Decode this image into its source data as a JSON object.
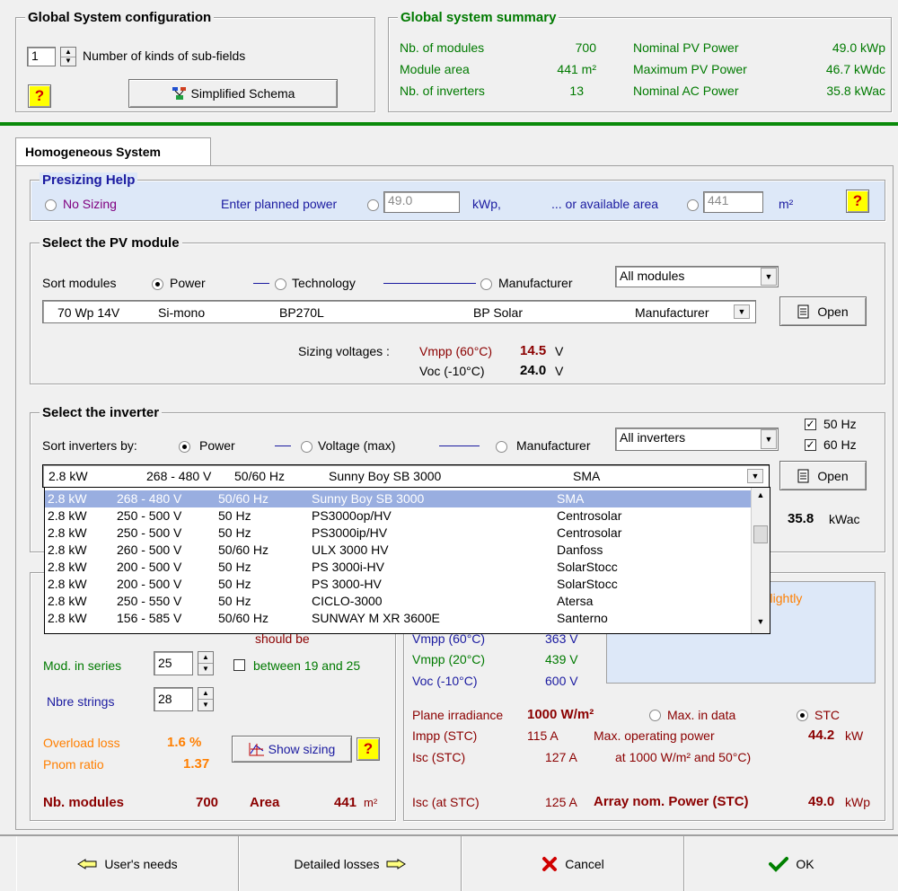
{
  "global_config": {
    "title": "Global System configuration",
    "kinds_value": "1",
    "kinds_label": "Number of kinds of sub-fields",
    "help": "?",
    "schema_button": "Simplified Schema"
  },
  "summary": {
    "title": "Global system summary",
    "rows": [
      {
        "label": "Nb. of modules",
        "value": "700",
        "label2": "Nominal PV Power",
        "value2": "49.0 kWp"
      },
      {
        "label": "Module area",
        "value": "441 m²",
        "label2": "Maximum PV Power",
        "value2": "46.7 kWdc"
      },
      {
        "label": "Nb. of inverters",
        "value": "13",
        "label2": "Nominal AC Power",
        "value2": "35.8 kWac"
      }
    ]
  },
  "tab": {
    "label": "Homogeneous System"
  },
  "presizing": {
    "title": "Presizing Help",
    "no_sizing": "No Sizing",
    "planned_power_label": "Enter planned power",
    "planned_power_value": "49.0",
    "planned_power_unit": "kWp,",
    "area_label": "... or available area",
    "area_value": "441",
    "area_unit": "m²",
    "help": "?"
  },
  "pv_module": {
    "title": "Select the PV module",
    "sort_label": "Sort modules",
    "sort_power": "Power",
    "sort_technology": "Technology",
    "sort_manufacturer": "Manufacturer",
    "filter_value": "All modules",
    "selected": {
      "power": "70 Wp 14V",
      "tech": "Si-mono",
      "model": "BP270L",
      "maker": "BP Solar",
      "source": "Manufacturer"
    },
    "open_button": "Open",
    "sizing_label": "Sizing voltages :",
    "vmpp_label": "Vmpp (60°C)",
    "vmpp_value": "14.5",
    "voc_label": "Voc (-10°C)",
    "voc_value": "24.0",
    "unit_v": "V"
  },
  "inverter": {
    "title": "Select the inverter",
    "hz50": "50 Hz",
    "hz60": "60 Hz",
    "sort_label": "Sort inverters by:",
    "sort_power": "Power",
    "sort_voltage": "Voltage (max)",
    "sort_manufacturer": "Manufacturer",
    "filter_value": "All inverters",
    "selected": {
      "power": "2.8 kW",
      "range": "268 - 480 V",
      "freq": "50/60 Hz",
      "model": "Sunny Boy SB 3000",
      "maker": "SMA"
    },
    "open_button": "Open",
    "ac_value": "35.8",
    "ac_unit": "kWac",
    "list": [
      {
        "power": "2.8 kW",
        "range": "268 - 480 V",
        "freq": "50/60 Hz",
        "model": "Sunny Boy SB 3000",
        "maker": "SMA"
      },
      {
        "power": "2.8 kW",
        "range": "250 - 500 V",
        "freq": "50 Hz",
        "model": "PS3000op/HV",
        "maker": "Centrosolar"
      },
      {
        "power": "2.8 kW",
        "range": "250 - 500 V",
        "freq": "50 Hz",
        "model": "PS3000ip/HV",
        "maker": "Centrosolar"
      },
      {
        "power": "2.8 kW",
        "range": "260 - 500 V",
        "freq": "50/60 Hz",
        "model": "ULX 3000 HV",
        "maker": "Danfoss"
      },
      {
        "power": "2.8 kW",
        "range": "200 - 500 V",
        "freq": "50 Hz",
        "model": "PS 3000i-HV",
        "maker": "SolarStocc"
      },
      {
        "power": "2.8 kW",
        "range": "200 - 500 V",
        "freq": "50 Hz",
        "model": "PS 3000-HV",
        "maker": "SolarStocc"
      },
      {
        "power": "2.8 kW",
        "range": "250 - 550 V",
        "freq": "50 Hz",
        "model": "CICLO-3000",
        "maker": "Atersa"
      },
      {
        "power": "2.8 kW",
        "range": "156 - 585 V",
        "freq": "50/60 Hz",
        "model": "SUNWAY M XR 3600E",
        "maker": "Santerno"
      }
    ]
  },
  "array_design": {
    "should_be": "should be",
    "mod_series_label": "Mod. in series",
    "mod_series_value": "25",
    "between_label": "between 19 and 25",
    "strings_label": "Nbre strings",
    "strings_value": "28",
    "overload_label": "Overload loss",
    "overload_value": "1.6 %",
    "pnom_label": "Pnom ratio",
    "pnom_value": "1.37",
    "show_sizing": "Show sizing",
    "help": "?",
    "nb_modules_label": "Nb. modules",
    "nb_modules_value": "700",
    "area_label": "Area",
    "area_value": "441",
    "area_unit": "m²",
    "warning_text_1": "r is slightly",
    "warning_text_2": "d.",
    "vmpp60_label": "Vmpp (60°C)",
    "vmpp60_value": "363 V",
    "vmpp20_label": "Vmpp (20°C)",
    "vmpp20_value": "439 V",
    "voc_label": "Voc (-10°C)",
    "voc_value": "600 V",
    "irradiance_label": "Plane irradiance",
    "irradiance_value": "1000 W/m²",
    "max_in_data": "Max. in data",
    "stc": "STC",
    "impp_label": "Impp (STC)",
    "impp_value": "115 A",
    "max_op_label": "Max. operating power",
    "max_op_value": "44.2",
    "max_op_unit": "kW",
    "isc_label": "Isc (STC)",
    "isc_value": "127 A",
    "at_conditions": "at 1000 W/m² and 50°C)",
    "isc_at_label": "Isc (at STC)",
    "isc_at_value": "125 A",
    "nom_power_label": "Array nom. Power (STC)",
    "nom_power_value": "49.0",
    "nom_power_unit": "kWp"
  },
  "bottom": {
    "users_needs": "User's needs",
    "detailed_losses": "Detailed losses",
    "cancel": "Cancel",
    "ok": "OK"
  },
  "colors": {
    "accent_green": "#007a00",
    "warning_orange": "#ff7f00",
    "value_darkred": "#8b0000",
    "title_blue": "#1a1aa0",
    "selection_blue": "#99aee0",
    "presizing_bg": "#dde8f8"
  }
}
